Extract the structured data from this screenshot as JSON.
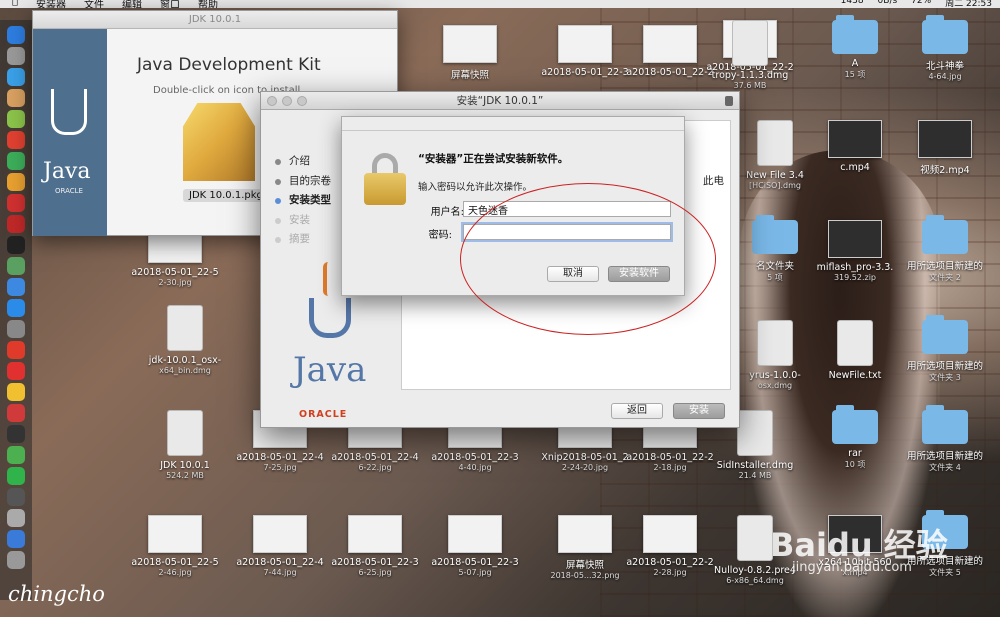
{
  "menubar": {
    "items": [
      "安装器",
      "文件",
      "编辑",
      "窗口",
      "帮助"
    ],
    "right": [
      "1438",
      "0B/s",
      "72%",
      "周二 22:53"
    ]
  },
  "jdk_window": {
    "title": "JDK 10.0.1",
    "heading": "Java Development Kit",
    "hint": "Double-click on icon to install",
    "package_label": "JDK 10.0.1.pkg",
    "side_java": "Java",
    "side_oracle": "ORACLE"
  },
  "installer": {
    "title": "安装“JDK 10.0.1”",
    "steps": [
      {
        "label": "介绍",
        "state": "done"
      },
      {
        "label": "目的宗卷",
        "state": "done"
      },
      {
        "label": "安装类型",
        "state": "active"
      },
      {
        "label": "安装",
        "state": "dim"
      },
      {
        "label": "摘要",
        "state": "dim"
      }
    ],
    "pane_peek": "此电",
    "java_word": "Java",
    "oracle_word": "ORACLE",
    "back_button": "返回",
    "install_button": "安装"
  },
  "auth": {
    "heading": "“安装器”正在尝试安装新软件。",
    "message": "输入密码以允许此次操作。",
    "username_label": "用户名:",
    "username_value": "天色迷香",
    "password_label": "密码:",
    "password_value": "",
    "cancel_button": "取消",
    "install_software_button": "安装软件"
  },
  "desktop": {
    "icons": [
      {
        "label": "屏幕快照",
        "sub": "",
        "kind": "thumb"
      },
      {
        "label": "a2018-05-01_22-3",
        "sub": "",
        "kind": "thumb"
      },
      {
        "label": "a2018-05-01_22-2",
        "sub": "",
        "kind": "thumb"
      },
      {
        "label": "a2018-05-01_22-2",
        "sub": "",
        "kind": "thumb"
      },
      {
        "label": "tropy-1.1.3.dmg",
        "sub": "37.6 MB",
        "kind": "disk"
      },
      {
        "label": "A",
        "sub": "15 项",
        "kind": "folder"
      },
      {
        "label": "北斗神拳",
        "sub": "4-64.jpg",
        "kind": "folder"
      },
      {
        "label": "New File 3.4",
        "sub": "[HCiSO].dmg",
        "kind": "disk"
      },
      {
        "label": "c.mp4",
        "sub": "",
        "kind": "dark"
      },
      {
        "label": "视频2.mp4",
        "sub": "",
        "kind": "dark"
      },
      {
        "label": "名文件夹",
        "sub": "5 项",
        "kind": "folder"
      },
      {
        "label": "miflash_pro-3.3.",
        "sub": "319.52.zip",
        "kind": "dark"
      },
      {
        "label": "用所选项目新建的",
        "sub": "文件夹 2",
        "kind": "folder"
      },
      {
        "label": "yrus-1.0.0-",
        "sub": "osx.dmg",
        "kind": "disk"
      },
      {
        "label": "NewFile.txt",
        "sub": "",
        "kind": "disk"
      },
      {
        "label": "用所选项目新建的",
        "sub": "文件夹 3",
        "kind": "folder"
      },
      {
        "label": "a2018-05-01_22-5",
        "sub": "2-30.jpg",
        "kind": "thumb"
      },
      {
        "label": "jdk-10.0.1_osx-",
        "sub": "x64_bin.dmg",
        "kind": "disk"
      },
      {
        "label": "JDK 10.0.1",
        "sub": "524.2 MB",
        "kind": "disk"
      },
      {
        "label": "a2018-05-01_22-4",
        "sub": "7-25.jpg",
        "kind": "thumb"
      },
      {
        "label": "a2018-05-01_22-4",
        "sub": "6-22.jpg",
        "kind": "thumb"
      },
      {
        "label": "a2018-05-01_22-3",
        "sub": "4-40.jpg",
        "kind": "thumb"
      },
      {
        "label": "Xnip2018-05-01_2",
        "sub": "2-24-20.jpg",
        "kind": "thumb"
      },
      {
        "label": "a2018-05-01_22-2",
        "sub": "2-18.jpg",
        "kind": "thumb"
      },
      {
        "label": "SidInstaller.dmg",
        "sub": "21.4 MB",
        "kind": "disk"
      },
      {
        "label": "rar",
        "sub": "10 项",
        "kind": "folder"
      },
      {
        "label": "用所选项目新建的",
        "sub": "文件夹 4",
        "kind": "folder"
      },
      {
        "label": "a2018-05-01_22-5",
        "sub": "2-46.jpg",
        "kind": "thumb"
      },
      {
        "label": "a2018-05-01_22-4",
        "sub": "7-44.jpg",
        "kind": "thumb"
      },
      {
        "label": "a2018-05-01_22-3",
        "sub": "6-25.jpg",
        "kind": "thumb"
      },
      {
        "label": "a2018-05-01_22-3",
        "sub": "5-07.jpg",
        "kind": "thumb"
      },
      {
        "label": "屏幕快照",
        "sub": "2018-05...32.png",
        "kind": "thumb"
      },
      {
        "label": "a2018-05-01_22-2",
        "sub": "2-28.jpg",
        "kind": "thumb"
      },
      {
        "label": "Nulloy-0.8.2.pre4",
        "sub": "6-x86_64.dmg",
        "kind": "disk"
      },
      {
        "label": "x264-10bit-560",
        "sub": "x.mp4",
        "kind": "dark"
      },
      {
        "label": "用所选项目新建的",
        "sub": "文件夹 5",
        "kind": "folder"
      }
    ]
  },
  "watermarks": {
    "signature": "chingcho",
    "baidu": "Baidu 经验",
    "baidu_url": "jingyan.baidu.com"
  },
  "colors": {
    "accent_focus": "#9dbde8",
    "annotation_red": "#cc2222",
    "oracle_red": "#d04020"
  }
}
